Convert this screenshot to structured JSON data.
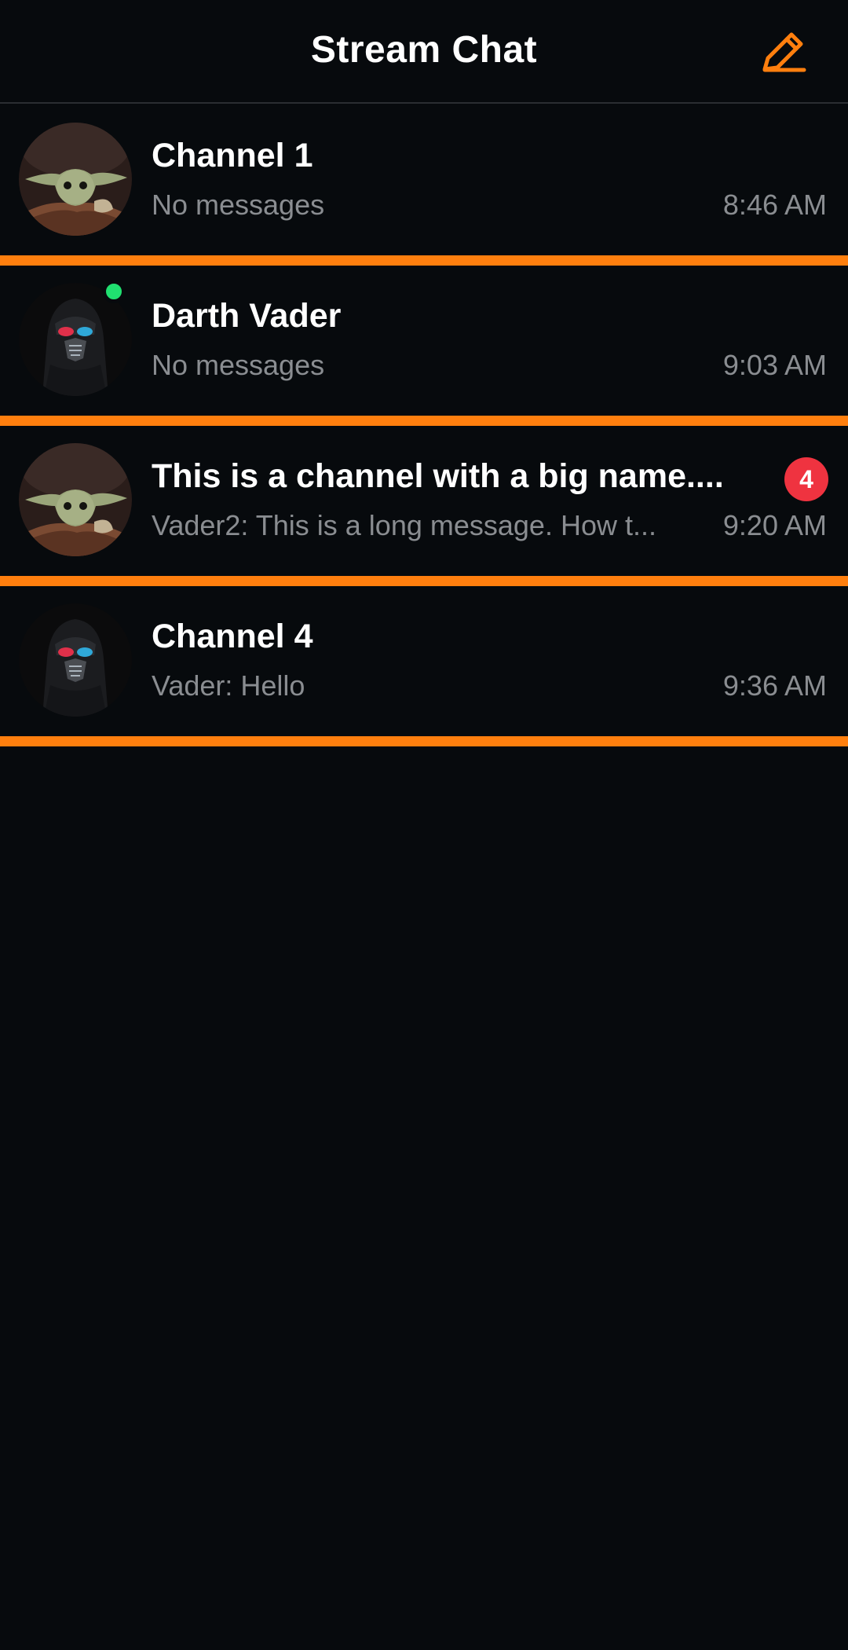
{
  "header": {
    "title": "Stream Chat",
    "compose_icon": "pencil-icon",
    "accent": "#ff7f0e"
  },
  "channels": [
    {
      "title": "Channel 1",
      "preview": "No messages",
      "time": "8:46 AM",
      "avatar": "baby-yoda-avatar",
      "online": false,
      "unread": ""
    },
    {
      "title": "Darth Vader",
      "preview": "No messages",
      "time": "9:03 AM",
      "avatar": "darth-vader-avatar",
      "online": true,
      "unread": ""
    },
    {
      "title": "This is a channel with a big name....",
      "preview": "Vader2: This is a long message. How t...",
      "time": "9:20 AM",
      "avatar": "baby-yoda-avatar",
      "online": false,
      "unread": "4"
    },
    {
      "title": "Channel 4",
      "preview": "Vader: Hello",
      "time": "9:36 AM",
      "avatar": "darth-vader-avatar",
      "online": false,
      "unread": ""
    }
  ],
  "colors": {
    "background": "#070a0d",
    "separator": "#ff7f0e",
    "unread_badge": "#ef3340",
    "online_dot": "#20e070",
    "secondary_text": "#8a8d91"
  }
}
